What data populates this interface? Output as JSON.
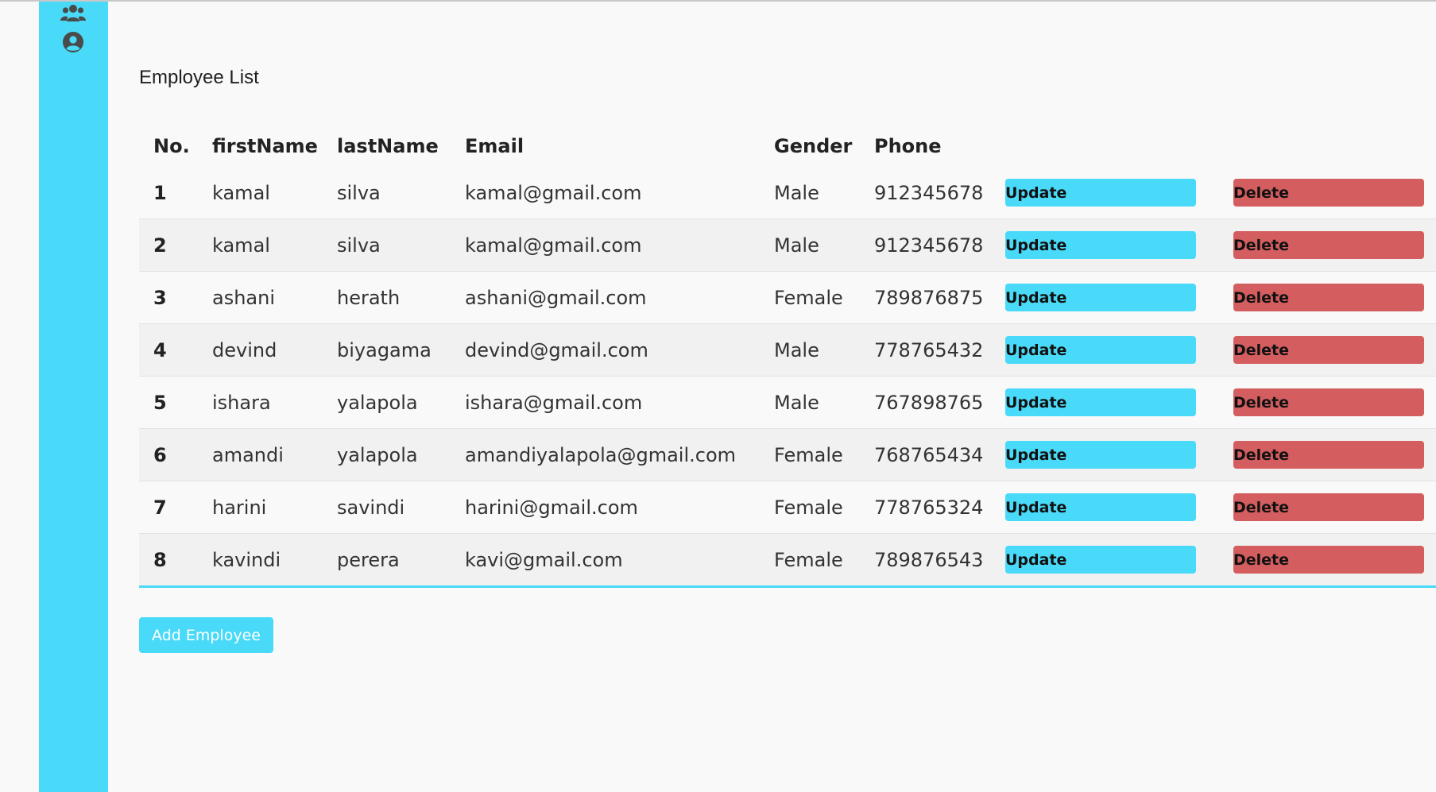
{
  "sidebar": {
    "icons": [
      "users-icon",
      "user-circle-icon"
    ],
    "color": "#48daf8"
  },
  "page": {
    "title": "Employee List"
  },
  "table": {
    "columns": [
      "No.",
      "firstName",
      "lastName",
      "Email",
      "Gender",
      "Phone"
    ],
    "rows": [
      {
        "no": "1",
        "firstName": "kamal",
        "lastName": "silva",
        "email": "kamal@gmail.com",
        "gender": "Male",
        "phone": "912345678"
      },
      {
        "no": "2",
        "firstName": "kamal",
        "lastName": "silva",
        "email": "kamal@gmail.com",
        "gender": "Male",
        "phone": "912345678"
      },
      {
        "no": "3",
        "firstName": "ashani",
        "lastName": "herath",
        "email": "ashani@gmail.com",
        "gender": "Female",
        "phone": "789876875"
      },
      {
        "no": "4",
        "firstName": "devind",
        "lastName": "biyagama",
        "email": "devind@gmail.com",
        "gender": "Male",
        "phone": "778765432"
      },
      {
        "no": "5",
        "firstName": "ishara",
        "lastName": "yalapola",
        "email": "ishara@gmail.com",
        "gender": "Male",
        "phone": "767898765"
      },
      {
        "no": "6",
        "firstName": "amandi",
        "lastName": "yalapola",
        "email": "amandiyalapola@gmail.com",
        "gender": "Female",
        "phone": "768765434"
      },
      {
        "no": "7",
        "firstName": "harini",
        "lastName": "savindi",
        "email": "harini@gmail.com",
        "gender": "Female",
        "phone": "778765324"
      },
      {
        "no": "8",
        "firstName": "kavindi",
        "lastName": "perera",
        "email": "kavi@gmail.com",
        "gender": "Female",
        "phone": "789876543"
      }
    ],
    "update_label": "Update",
    "delete_label": "Delete",
    "update_color": "#48daf8",
    "delete_color": "#d45d5f"
  },
  "actions": {
    "add_label": "Add Employee"
  }
}
